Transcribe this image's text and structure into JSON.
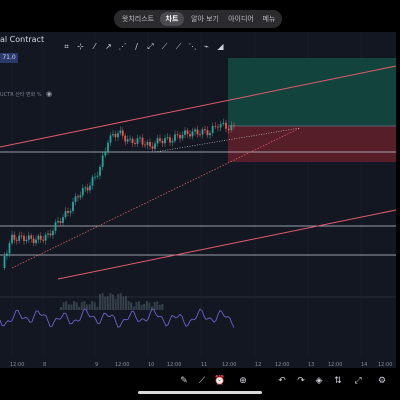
{
  "nav": {
    "tabs": [
      {
        "label": "왓치리스트",
        "active": false
      },
      {
        "label": "차트",
        "active": true
      },
      {
        "label": "알아 보기",
        "active": false
      },
      {
        "label": "아이디어",
        "active": false
      },
      {
        "label": "메뉴",
        "active": false
      }
    ]
  },
  "symbol": {
    "name_fragment": "al Contract",
    "price_badge": "71.0"
  },
  "indicator": {
    "label_fragment": "UCTR 산타 변화 %"
  },
  "toolbar": {
    "tools": [
      "save-icon",
      "crosshair-icon",
      "trend-line-icon",
      "arrow-icon",
      "fib-icon",
      "brush-icon",
      "text-icon",
      "pattern-icon",
      "ruler-icon",
      "forecast-icon",
      "magnet-icon",
      "eraser-icon"
    ]
  },
  "time_axis": {
    "labels": [
      "12:00",
      "8",
      "9",
      "12:00",
      "10",
      "12:00",
      "11",
      "12:00",
      "12",
      "12:00",
      "13",
      "12:00",
      "14",
      "12:00"
    ]
  },
  "bottom_toolbar": {
    "tools": [
      "pencil-icon",
      "draw-icon",
      "alert-clock-icon",
      "indicators-icon",
      "add-plus-icon",
      "candle-type-icon",
      "undo-icon",
      "redo-icon",
      "layers-icon",
      "compare-icon",
      "fullscreen-icon",
      "settings-icon"
    ]
  },
  "colors": {
    "background": "#131722",
    "bull_candle": "#26a69a",
    "bear_candle": "#ef5350",
    "trend_channel": "#e45b6a",
    "target_zone": "#13463f",
    "stop_zone": "#5a1f2a",
    "rsi_line": "#6e5fc8"
  }
}
